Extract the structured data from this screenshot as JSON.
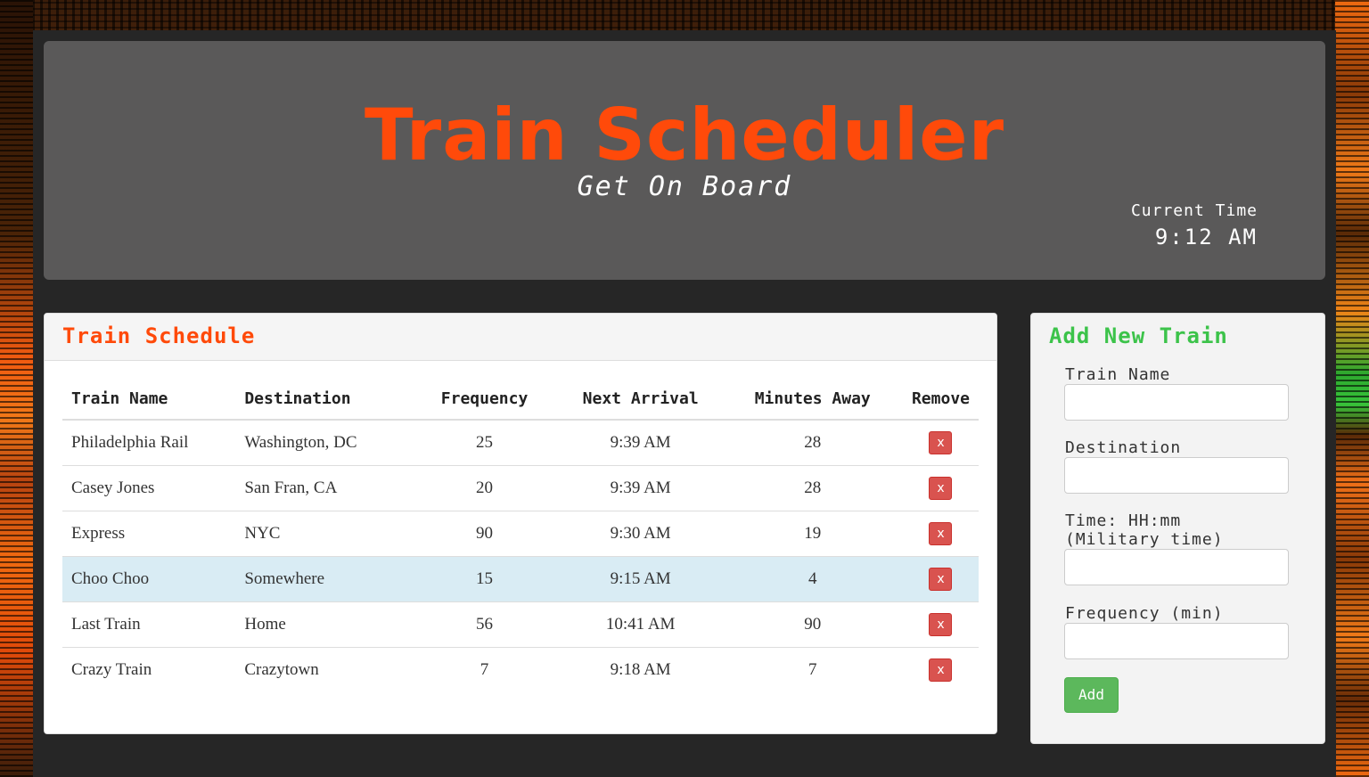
{
  "header": {
    "title": "Train Scheduler",
    "subtitle": "Get On Board",
    "clock_label": "Current Time",
    "clock_time": "9:12 AM"
  },
  "schedule": {
    "title": "Train Schedule",
    "columns": [
      "Train Name",
      "Destination",
      "Frequency",
      "Next Arrival",
      "Minutes Away",
      "Remove"
    ],
    "rows": [
      {
        "name": "Philadelphia Rail",
        "destination": "Washington, DC",
        "frequency": "25",
        "next_arrival": "9:39 AM",
        "minutes_away": "28",
        "remove": "x"
      },
      {
        "name": "Casey Jones",
        "destination": "San Fran, CA",
        "frequency": "20",
        "next_arrival": "9:39 AM",
        "minutes_away": "28",
        "remove": "x"
      },
      {
        "name": "Express",
        "destination": "NYC",
        "frequency": "90",
        "next_arrival": "9:30 AM",
        "minutes_away": "19",
        "remove": "x"
      },
      {
        "name": "Choo Choo",
        "destination": "Somewhere",
        "frequency": "15",
        "next_arrival": "9:15 AM",
        "minutes_away": "4",
        "remove": "x"
      },
      {
        "name": "Last Train",
        "destination": "Home",
        "frequency": "56",
        "next_arrival": "10:41 AM",
        "minutes_away": "90",
        "remove": "x"
      },
      {
        "name": "Crazy Train",
        "destination": "Crazytown",
        "frequency": "7",
        "next_arrival": "9:18 AM",
        "minutes_away": "7",
        "remove": "x"
      }
    ]
  },
  "form": {
    "title": "Add New Train",
    "name_label": "Train Name",
    "destination_label": "Destination",
    "time_label_1": "Time: HH:mm",
    "time_label_2": "(Military time)",
    "frequency_label": "Frequency (min)",
    "name_value": "",
    "destination_value": "",
    "time_value": "",
    "frequency_value": "",
    "add_label": "Add"
  },
  "colors": {
    "accent_orange": "#ff4a0a",
    "accent_green": "#3cc34a",
    "remove_red": "#d9534f",
    "add_green": "#5cb85c",
    "highlight_row": "#d9ecf4"
  }
}
